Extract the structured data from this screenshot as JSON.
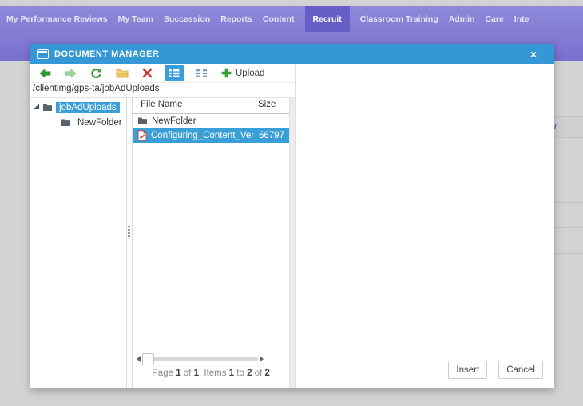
{
  "nav": {
    "items": [
      {
        "label": "My Performance Reviews",
        "active": false
      },
      {
        "label": "My Team",
        "active": false
      },
      {
        "label": "Succession",
        "active": false
      },
      {
        "label": "Reports",
        "active": false
      },
      {
        "label": "Content",
        "active": false
      },
      {
        "label": "Recruit",
        "active": true
      },
      {
        "label": "Classroom Training",
        "active": false
      },
      {
        "label": "Admin",
        "active": false
      },
      {
        "label": "Care",
        "active": false
      },
      {
        "label": "Inte",
        "active": false
      }
    ]
  },
  "background": {
    "partial_link_text": "w"
  },
  "dialog": {
    "title": "DOCUMENT MANAGER",
    "close_glyph": "×",
    "toolbar": {
      "upload_label": "Upload"
    },
    "address": "/clientimg/gps-ta/jobAdUploads",
    "tree": {
      "items": [
        {
          "label": "jobAdUploads",
          "selected": true,
          "expanded": true
        },
        {
          "label": "NewFolder",
          "selected": false
        }
      ]
    },
    "list": {
      "columns": [
        "File Name",
        "Size"
      ],
      "rows": [
        {
          "name": "NewFolder",
          "type": "folder",
          "size": "",
          "selected": false
        },
        {
          "name": "Configuring_Content_Vendo",
          "type": "pdf",
          "size": "66797",
          "selected": true
        }
      ],
      "pager_parts": [
        "Page ",
        "1",
        " of ",
        "1",
        ". Items ",
        "1",
        " to ",
        "2",
        " of ",
        "2"
      ]
    },
    "buttons": {
      "insert": "Insert",
      "cancel": "Cancel"
    },
    "colors": {
      "titlebar": "#3398d5",
      "selection": "#3a9fd8",
      "nav_purple": "#8e89da",
      "nav_active": "#675ec8",
      "overlay_gray": "#d3d3d5"
    }
  }
}
